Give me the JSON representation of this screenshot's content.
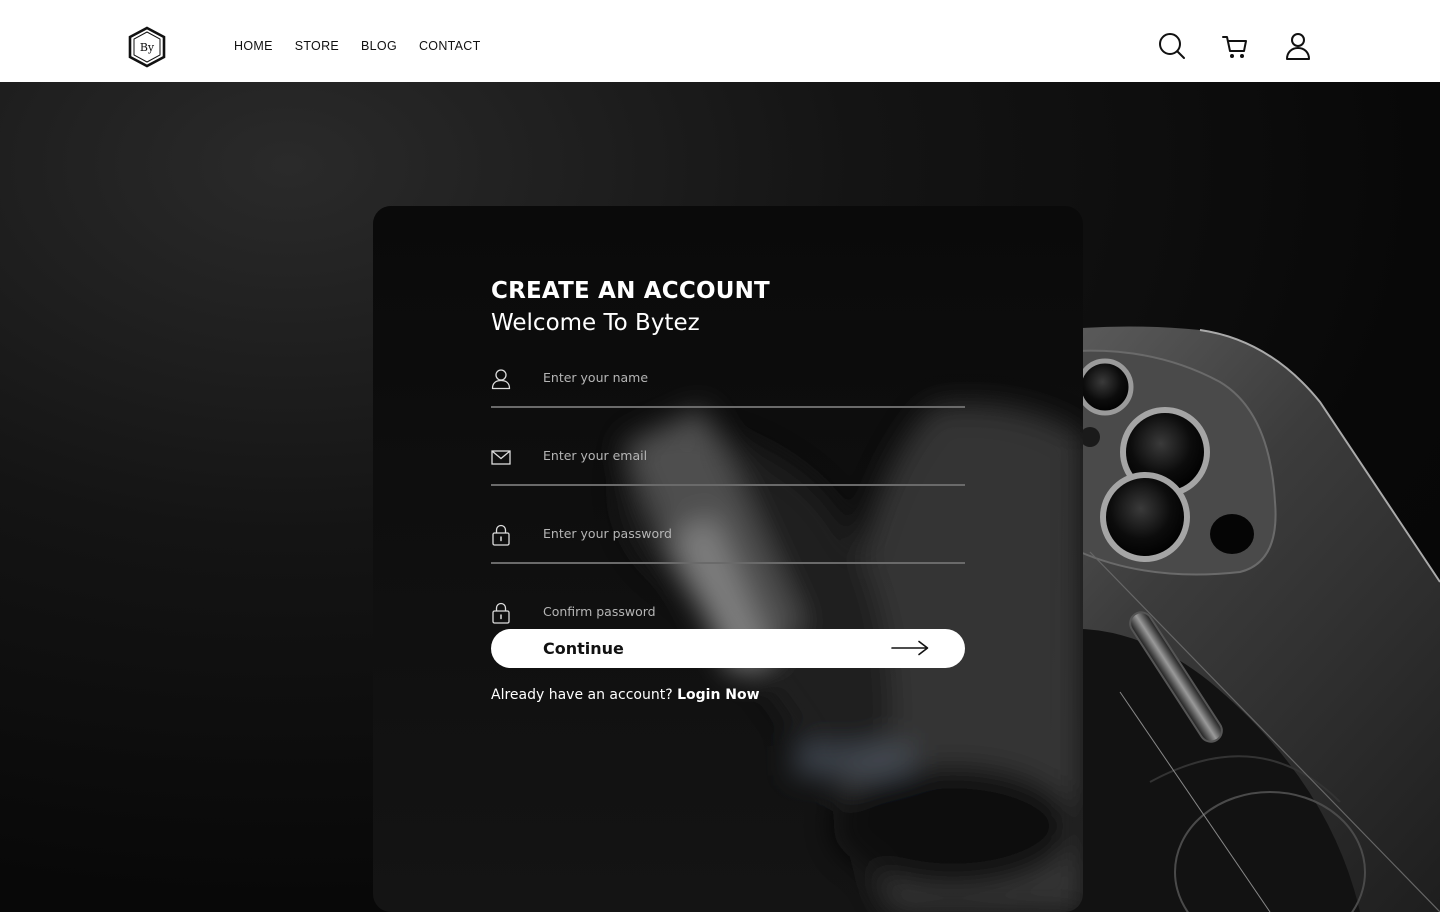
{
  "header": {
    "logo_text": "By",
    "nav": [
      {
        "label": "HOME"
      },
      {
        "label": "STORE"
      },
      {
        "label": "BLOG"
      },
      {
        "label": "CONTACT"
      }
    ],
    "icons": [
      "search-icon",
      "cart-icon",
      "user-icon"
    ]
  },
  "form": {
    "title": "CREATE AN ACCOUNT",
    "subtitle": "Welcome To Bytez",
    "fields": [
      {
        "icon": "user-icon",
        "placeholder": "Enter your name",
        "value": ""
      },
      {
        "icon": "mail-icon",
        "placeholder": "Enter your email",
        "value": ""
      },
      {
        "icon": "lock-icon",
        "placeholder": "Enter your password",
        "value": ""
      },
      {
        "icon": "lock-icon",
        "placeholder": "Confirm password",
        "value": ""
      }
    ],
    "continue_label": "Continue",
    "login_prompt": "Already have an account?",
    "login_link": "Login Now"
  },
  "colors": {
    "header_bg": "#ffffff",
    "page_bg": "#0b0b0b",
    "button_bg": "#ffffff",
    "text_light": "#ffffff"
  }
}
